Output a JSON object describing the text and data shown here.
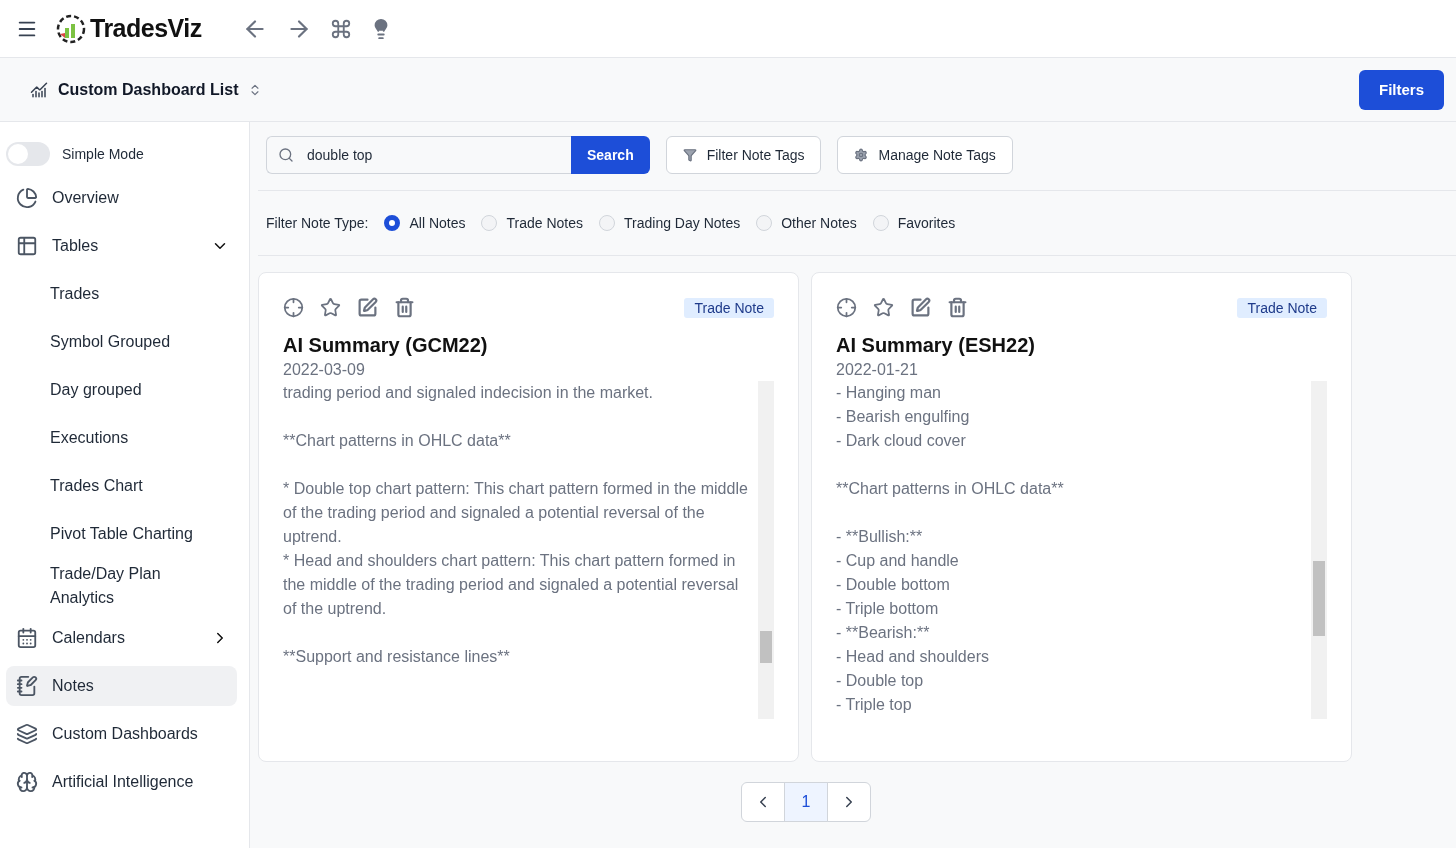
{
  "header": {
    "brand": "TradesViz"
  },
  "dashboard_bar": {
    "title": "Custom Dashboard List",
    "filters_button": "Filters"
  },
  "sidebar": {
    "simple_mode": {
      "label": "Simple Mode",
      "on": false
    },
    "items": [
      {
        "label": "Overview",
        "selected": false
      },
      {
        "label": "Tables",
        "selected": false,
        "expanded": true,
        "children": [
          {
            "label": "Trades",
            "selected": false
          },
          {
            "label": "Symbol Grouped",
            "selected": false
          },
          {
            "label": "Day grouped",
            "selected": false
          },
          {
            "label": "Executions",
            "selected": false
          },
          {
            "label": "Trades Chart",
            "selected": false
          },
          {
            "label": "Pivot Table Charting",
            "selected": false
          },
          {
            "label": "Trade/Day Plan Analytics",
            "selected": false
          }
        ]
      },
      {
        "label": "Calendars",
        "selected": false,
        "expanded": false
      },
      {
        "label": "Notes",
        "selected": true
      },
      {
        "label": "Custom Dashboards",
        "selected": false
      },
      {
        "label": "Artificial Intelligence",
        "selected": false
      }
    ]
  },
  "search": {
    "value": "double top",
    "button": "Search"
  },
  "tag_buttons": [
    {
      "label": "Filter Note Tags"
    },
    {
      "label": "Manage Note Tags"
    }
  ],
  "note_type_filter": {
    "label": "Filter Note Type:",
    "options": [
      {
        "label": "All Notes",
        "selected": true
      },
      {
        "label": "Trade Notes",
        "selected": false
      },
      {
        "label": "Trading Day Notes",
        "selected": false
      },
      {
        "label": "Other Notes",
        "selected": false
      },
      {
        "label": "Favorites",
        "selected": false
      }
    ]
  },
  "notes": [
    {
      "tag": "Trade Note",
      "title": "AI Summary (GCM22)",
      "date": "2022-03-09",
      "paragraphs": [
        [
          "trading period and signaled indecision in the market."
        ],
        [
          "**Chart patterns in OHLC data**"
        ],
        [
          "* Double top chart pattern: This chart pattern formed in the middle of the trading period and signaled a potential reversal of the uptrend.",
          "* Head and shoulders chart pattern: This chart pattern formed in the middle of the trading period and signaled a potential reversal of the uptrend."
        ],
        [
          "**Support and resistance lines**"
        ]
      ]
    },
    {
      "tag": "Trade Note",
      "title": "AI Summary (ESH22)",
      "date": "2022-01-21",
      "paragraphs": [
        [
          "- Hanging man",
          "- Bearish engulfing",
          "- Dark cloud cover"
        ],
        [
          "**Chart patterns in OHLC data**"
        ],
        [
          "- **Bullish:**",
          "- Cup and handle",
          "- Double bottom",
          "- Triple bottom",
          "- **Bearish:**",
          "- Head and shoulders",
          "- Double top",
          "- Triple top"
        ]
      ]
    }
  ],
  "pagination": {
    "pages": [
      {
        "label": "1",
        "selected": true
      }
    ]
  }
}
